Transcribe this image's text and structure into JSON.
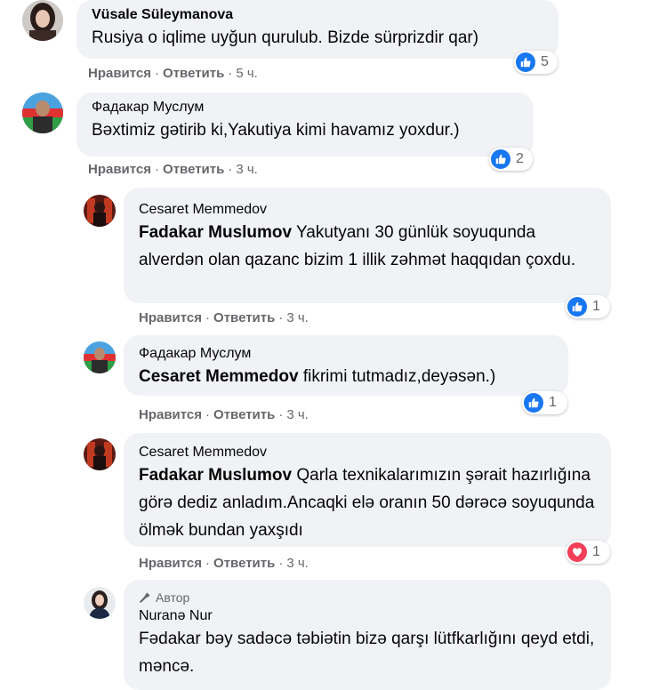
{
  "comments": [
    {
      "author": "Vüsale Süleymanova",
      "text": "Rusiya o iqlime uyğun qurulub. Bizde sürprizdir qar)",
      "like": "Нравится",
      "reply": "Ответить",
      "time": "5 ч.",
      "reactions": "5",
      "reaction_type": "like"
    },
    {
      "author": "Фадакар Муслум",
      "text": "Bəxtimiz gətirib ki,Yakutiya kimi havamız yoxdur.)",
      "like": "Нравится",
      "reply": "Ответить",
      "time": "3 ч.",
      "reactions": "2",
      "reaction_type": "like"
    },
    {
      "author": "Cesaret Memmedov",
      "mention": "Fadakar Muslumov",
      "text": "Yakutyanı 30 günlük soyuqunda alverdən olan qazanc bizim 1 illik zəhmət haqqıdan çoxdu.",
      "like": "Нравится",
      "reply": "Ответить",
      "time": "3 ч.",
      "reactions": "1",
      "reaction_type": "like"
    },
    {
      "author": "Фадакар Муслум",
      "mention": "Cesaret Memmedov",
      "text": "fikrimi tutmadız,deyəsən.)",
      "like": "Нравится",
      "reply": "Ответить",
      "time": "3 ч.",
      "reactions": "1",
      "reaction_type": "like"
    },
    {
      "author": "Cesaret Memmedov",
      "mention": "Fadakar Muslumov",
      "text": "Qarla texnikalarımızın şərait hazırlığına görə dediz anladım.Ancaqki elə oranın 50 dərəcə soyuqunda ölmək bundan yaxşıdı",
      "like": "Нравится",
      "reply": "Ответить",
      "time": "3 ч.",
      "reactions": "1",
      "reaction_type": "love"
    },
    {
      "badge": "Автор",
      "author": "Nuranə Nur",
      "text": "Fədakar bəy sadəcə təbiətin bizə qarşı lütfkarlığını qeyd etdi, məncə."
    }
  ],
  "icons": {
    "like": "thumbs-up-icon",
    "love": "heart-icon",
    "author_badge": "microphone-icon"
  },
  "colors": {
    "like": "#1877f2",
    "love": "#f33e58",
    "bubble": "#f0f2f5",
    "meta": "#65676b"
  }
}
